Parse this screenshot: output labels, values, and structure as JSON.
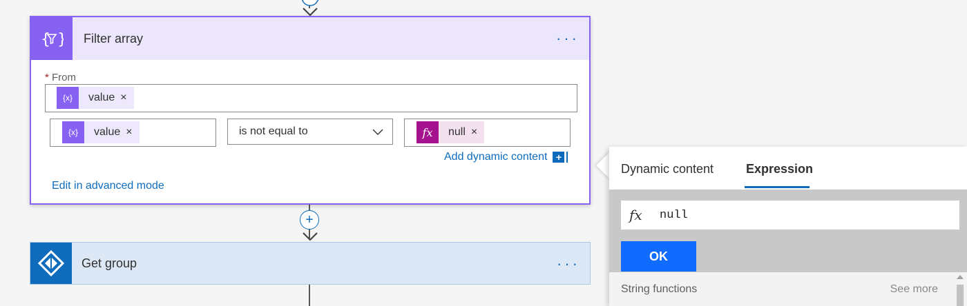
{
  "filter_card": {
    "title": "Filter array",
    "more_label": "···",
    "from_required_mark": "*",
    "from_label": "From",
    "from_token": {
      "label": "value",
      "remove": "×",
      "icon": "{x}"
    },
    "condition": {
      "left_token": {
        "label": "value",
        "remove": "×",
        "icon": "{x}"
      },
      "operator": "is not equal to",
      "right_token": {
        "label": "null",
        "remove": "×",
        "icon": "fx"
      }
    },
    "add_dynamic_content": "Add dynamic content",
    "add_icon": "+",
    "edit_advanced": "Edit in advanced mode"
  },
  "connector_plus": "+",
  "group_card": {
    "title": "Get group",
    "more_label": "···"
  },
  "expression_panel": {
    "tabs": [
      {
        "label": "Dynamic content",
        "active": false
      },
      {
        "label": "Expression",
        "active": true
      }
    ],
    "fx_symbol": "fx",
    "expression_value": "null",
    "ok_label": "OK",
    "section_label": "String functions",
    "see_more_label": "See more"
  },
  "colors": {
    "accent_purple": "#8661f2",
    "accent_blue": "#0f6cbd",
    "ok_blue": "#0f6cff",
    "expression_magenta": "#a4128f"
  }
}
